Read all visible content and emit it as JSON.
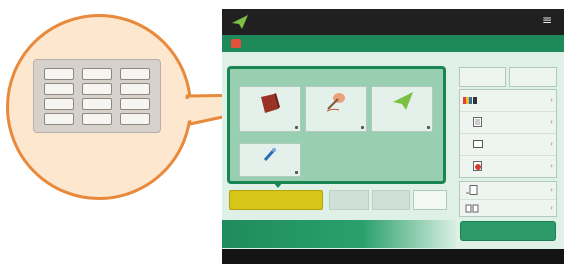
{
  "callout": {
    "keypad_rows": 4,
    "keypad_cols": 3
  },
  "header": {
    "menu_glyph": "≡"
  },
  "side_panel": {
    "color_mode_label": "█/█"
  },
  "colors": {
    "accent_green": "#1e8a5a",
    "highlight_yellow": "#d7c61a",
    "callout_orange": "#e9893b"
  }
}
